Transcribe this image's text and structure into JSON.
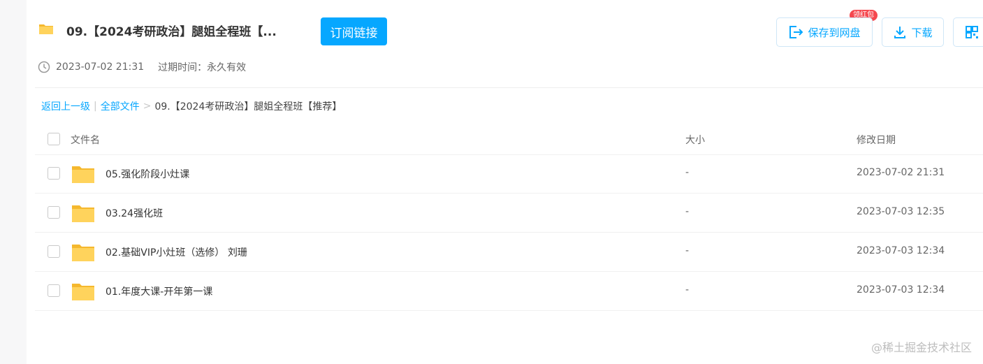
{
  "share": {
    "title": "09.【2024考研政治】腿姐全程班【...",
    "subscribe_label": "订阅链接",
    "created": "2023-07-02 21:31",
    "expire_label": "过期时间：永久有效"
  },
  "actions": {
    "save_label": "保存到网盘",
    "save_badge": "领红包",
    "download_label": "下载"
  },
  "breadcrumb": {
    "back": "返回上一级",
    "sep1": "|",
    "all_files": "全部文件",
    "sep2": ">",
    "current": "09.【2024考研政治】腿姐全程班【推荐】"
  },
  "table": {
    "headers": {
      "name": "文件名",
      "size": "大小",
      "modified": "修改日期"
    },
    "rows": [
      {
        "name": "05.强化阶段小灶课",
        "size": "-",
        "modified": "2023-07-02 21:31"
      },
      {
        "name": "03.24强化班",
        "size": "-",
        "modified": "2023-07-03 12:35"
      },
      {
        "name": "02.基础VIP小灶班（选修） 刘珊",
        "size": "-",
        "modified": "2023-07-03 12:34"
      },
      {
        "name": "01.年度大课-开年第一课",
        "size": "-",
        "modified": "2023-07-03 12:34"
      }
    ]
  },
  "watermark": "@稀土掘金技术社区",
  "colors": {
    "accent": "#06a7ff",
    "badge": "#f5484f",
    "folder": "#ffd35c"
  },
  "icons": {
    "title": "folder-icon",
    "created": "clock-icon",
    "save": "save-to-cloud-icon",
    "download": "download-icon",
    "more": "qr-code-icon",
    "row": "folder-icon"
  }
}
